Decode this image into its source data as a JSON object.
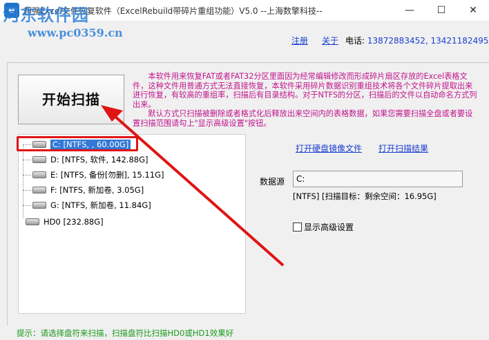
{
  "window": {
    "title": "超强Excel文件恢复软件（ExcelRebuild带碎片重组功能）V5.0  --上海数擎科技--",
    "watermark_main": "河东软件园",
    "watermark_url": "www.pc0359.cn",
    "controls": {
      "minimize": "—",
      "maximize": "☐",
      "close": "✕"
    }
  },
  "header": {
    "register": "注册",
    "about": "关于",
    "phone_label": "电话:",
    "phone_numbers": "13872883452, 13421182495"
  },
  "main": {
    "start_button": "开始扫描",
    "info_p1": "本软件用来恢复FAT或者FAT32分区里面因为经常编辑修改而形成碎片扇区存放的Excel表格文件，这种文件用普通方式无法直接恢复，本软件采用碎片数据识别重组技术将各个文件碎片提取出来进行恢复，有较高的重组率，扫描后有目录结构。对于NTFS的分区，扫描后的文件以自动命名方式列出来。",
    "info_p2": "默认方式只扫描被删除或者格式化后释放出来空间内的表格数据，如果您需要扫描全盘或者要设置扫描范围请勾上\"显示高级设置\"按钮。"
  },
  "tree": {
    "items": [
      {
        "label": "C:  [NTFS, , 60.00G]"
      },
      {
        "label": "D:  [NTFS, 软件, 142.88G]"
      },
      {
        "label": "E:  [NTFS, 备份[勿删], 15.11G]"
      },
      {
        "label": "F:  [NTFS, 新加卷, 3.05G]"
      },
      {
        "label": "G:  [NTFS, 新加卷, 11.84G]"
      },
      {
        "label": "HD0   [232.88G]"
      }
    ]
  },
  "right": {
    "open_image": "打开硬盘镜像文件",
    "open_result": "打开扫描结果",
    "source_label": "数据源",
    "source_value": "C:",
    "scan_info": "[NTFS]  [扫描目标：剩余空间：16.95G]",
    "advanced": "显示高级设置"
  },
  "status": {
    "hint": "提示：请选择盘符来扫描，扫描盘符比扫描HD0或HD1效果好"
  },
  "colors": {
    "annotation_red": "#e01414",
    "info_magenta": "#c0148c",
    "link_blue": "#1a3fd0",
    "hint_green": "#1a9a1a"
  }
}
